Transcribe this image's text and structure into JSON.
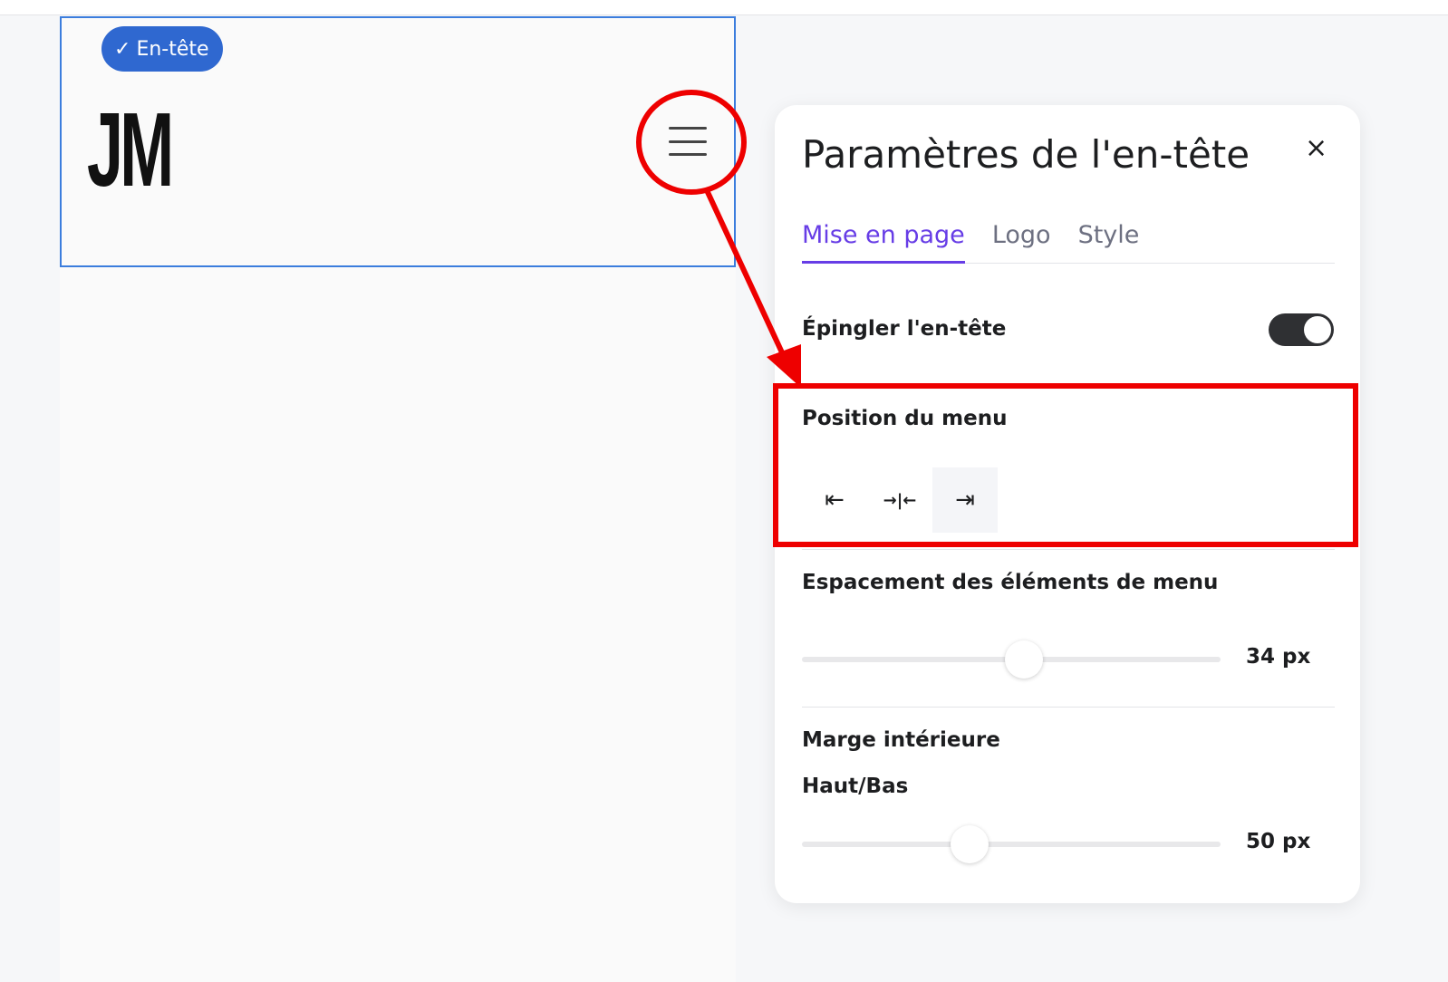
{
  "preview": {
    "badge_label": "En-tête",
    "logo_text": "JM"
  },
  "panel": {
    "title": "Paramètres de l'en-tête",
    "close_icon": "×",
    "tabs": [
      {
        "label": "Mise en page",
        "active": true
      },
      {
        "label": "Logo",
        "active": false
      },
      {
        "label": "Style",
        "active": false
      }
    ],
    "pin_header": {
      "label": "Épingler l'en-tête",
      "enabled": true
    },
    "menu_position": {
      "label": "Position du menu",
      "options": [
        "left",
        "center",
        "right"
      ],
      "icons": [
        "⇤",
        "→|←",
        "⇥"
      ],
      "selected": "right"
    },
    "item_spacing": {
      "label": "Espacement des éléments de menu",
      "value": "34 px",
      "fraction": 0.53
    },
    "padding": {
      "label": "Marge intérieure",
      "sub_label": "Haut/Bas",
      "value": "50 px",
      "fraction": 0.4
    }
  },
  "colors": {
    "accent": "#673de6",
    "annotation": "#ee0000",
    "selection": "#3b7ddd"
  }
}
